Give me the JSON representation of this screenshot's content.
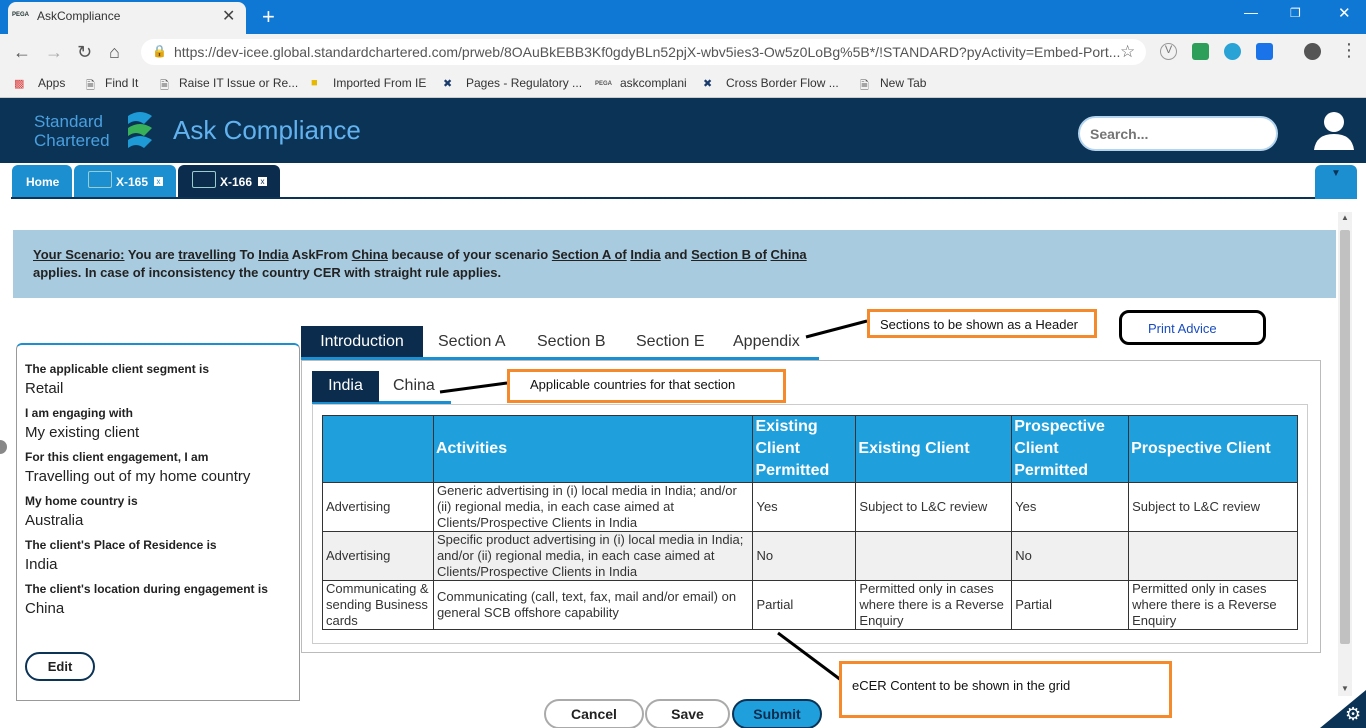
{
  "browser": {
    "tab_favicon": "PEGA",
    "tab_title": "AskCompliance",
    "tab_close": "✕",
    "new_tab": "+",
    "url": "https://dev-icee.global.standardchartered.com/prweb/8OAuBkEBB3Kf0gdyBLn52pjX-wbv5ies3-Ow5z0LoBg%5B*/!STANDARD?pyActivity=Embed-Port...",
    "bookmarks": [
      {
        "label": "Apps",
        "icon": "apps-grid-icon"
      },
      {
        "label": "Find It",
        "icon": "page-icon"
      },
      {
        "label": "Raise IT Issue or Re...",
        "icon": "page-icon"
      },
      {
        "label": "Imported From IE",
        "icon": "folder-icon"
      },
      {
        "label": "Pages - Regulatory ...",
        "icon": "x-tool-icon"
      },
      {
        "label": "askcomplani",
        "icon": "pega-icon"
      },
      {
        "label": "Cross Border Flow ...",
        "icon": "x-tool-icon"
      },
      {
        "label": "New Tab",
        "icon": "page-icon"
      }
    ]
  },
  "header": {
    "logo_line1": "Standard",
    "logo_line2": "Chartered",
    "title": "Ask Compliance",
    "search_placeholder": "Search..."
  },
  "work_tabs": [
    {
      "label": "Home"
    },
    {
      "label": "X-165",
      "close": "x"
    },
    {
      "label": "X-166",
      "close": "x"
    }
  ],
  "scenario": {
    "label": "Your Scenario:",
    "t1": "You are",
    "v1": "travelling",
    "t2": "To",
    "v2": "India",
    "t3": "AskFrom",
    "v3": "China",
    "t4": "because of your scenario",
    "v4": "Section A of",
    "v5": "India",
    "t5": "and",
    "v6": "Section B of",
    "v7": "China",
    "line2": "applies. In case of inconsistency the country CER with straight rule applies."
  },
  "details": [
    {
      "q": "The applicable client segment is",
      "a": "Retail"
    },
    {
      "q": "I am engaging with",
      "a": "My existing client"
    },
    {
      "q": "For this client engagement, I am",
      "a": "Travelling out of my home country"
    },
    {
      "q": "My home country is",
      "a": "Australia"
    },
    {
      "q": "The client's Place of Residence is",
      "a": "India"
    },
    {
      "q": "The client's location during engagement is",
      "a": "China"
    }
  ],
  "edit_label": "Edit",
  "section_tabs": [
    "Introduction",
    "Section A",
    "Section B",
    "Section E",
    "Appendix"
  ],
  "country_tabs": [
    "India",
    "China"
  ],
  "print_advice": "Print Advice",
  "annotations": {
    "sections": "Sections to be shown as a Header",
    "countries": "Applicable countries for that section",
    "grid": "eCER Content to be shown in the grid"
  },
  "grid": {
    "headers": [
      "",
      "Activities",
      "Existing Client Permitted",
      "Existing Client",
      "Prospective Client Permitted",
      "Prospective Client"
    ],
    "rows": [
      [
        "Advertising",
        "Generic advertising in (i) local media in India; and/or (ii) regional media, in each case aimed at Clients/Prospective Clients in India",
        "Yes",
        "Subject to L&C review",
        "Yes",
        "Subject to L&C review"
      ],
      [
        "Advertising",
        "Specific product advertising in (i) local media in India; and/or (ii) regional media, in each case aimed at Clients/Prospective Clients in India",
        "No",
        "",
        "No",
        ""
      ],
      [
        "Communicating & sending Business cards",
        "Communicating (call, text, fax, mail and/or email) on general SCB offshore capability",
        "Partial",
        "Permitted only in cases where there is a Reverse Enquiry",
        "Partial",
        "Permitted only in cases where there is a Reverse Enquiry"
      ]
    ]
  },
  "buttons": {
    "cancel": "Cancel",
    "save": "Save",
    "submit": "Submit"
  },
  "colors": {
    "header_bg": "#0b3356",
    "accent": "#1fa0dd",
    "annotation": "#f58a2c",
    "scenario_bg": "#a8cbe0"
  }
}
